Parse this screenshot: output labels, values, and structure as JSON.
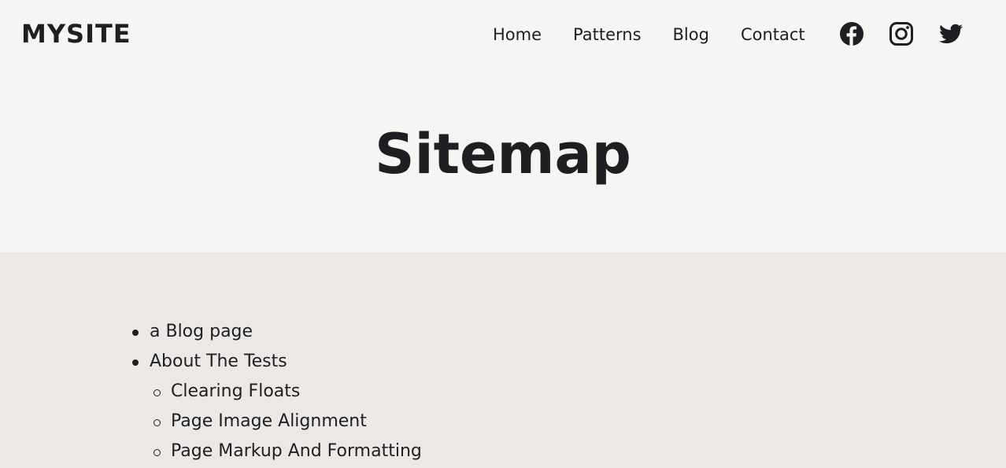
{
  "header": {
    "brand": "MYSITE",
    "nav": [
      "Home",
      "Patterns",
      "Blog",
      "Contact"
    ],
    "social": [
      "facebook-icon",
      "instagram-icon",
      "twitter-icon"
    ]
  },
  "page": {
    "title": "Sitemap"
  },
  "sitemap": {
    "items": [
      {
        "label": "a Blog page",
        "level": 1
      },
      {
        "label": "About The Tests",
        "level": 1
      },
      {
        "label": "Clearing Floats",
        "level": 2
      },
      {
        "label": "Page Image Alignment",
        "level": 2
      },
      {
        "label": "Page Markup And Formatting",
        "level": 2
      }
    ]
  },
  "colors": {
    "text": "#1e1f22",
    "header_bg": "#f6f5f3",
    "content_bg": "#ece8e5"
  }
}
